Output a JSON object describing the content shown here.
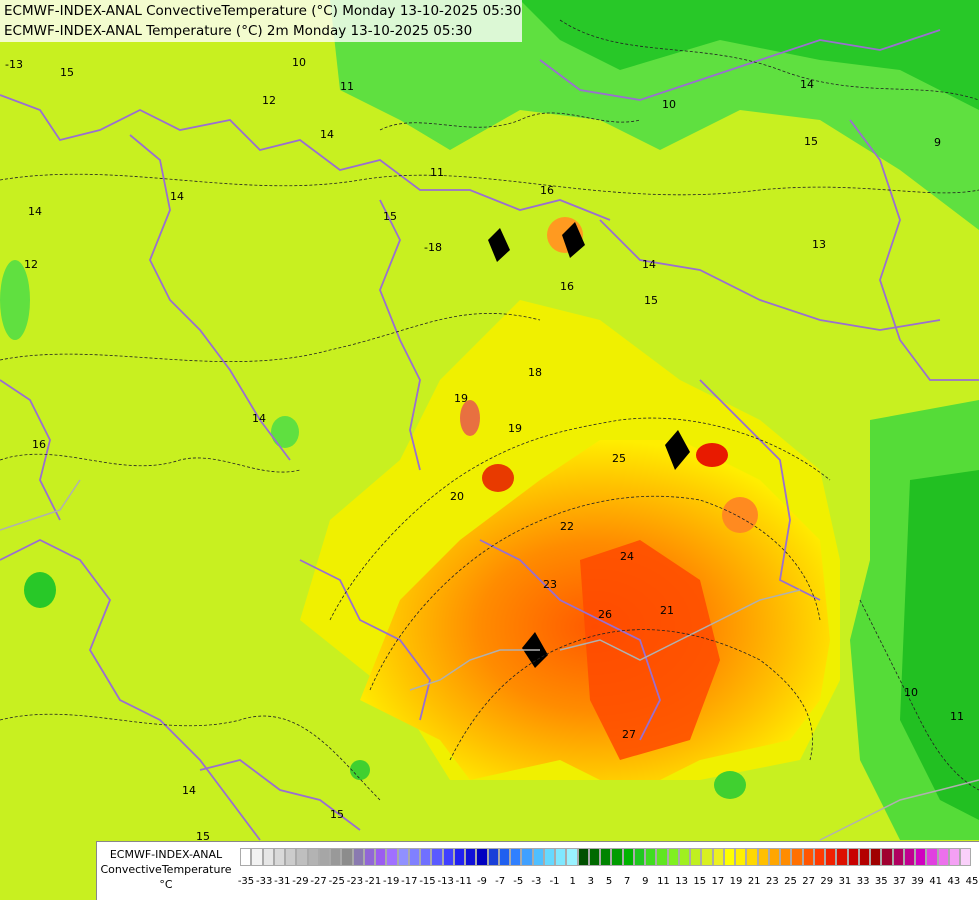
{
  "titles": {
    "line1": "ECMWF-INDEX-ANAL ConvectiveTemperature (°C) Monday 13-10-2025 05:30",
    "line2": "ECMWF-INDEX-ANAL Temperature (°C) 2m Monday 13-10-2025 05:30"
  },
  "legend": {
    "caption_line1": "ECMWF-INDEX-ANAL",
    "caption_line2": "ConvectiveTemperature",
    "caption_line3": "°C",
    "ticks": [
      "-35",
      "-33",
      "-31",
      "-29",
      "-27",
      "-25",
      "-23",
      "-21",
      "-19",
      "-17",
      "-15",
      "-13",
      "-11",
      "-9",
      "-7",
      "-5",
      "-3",
      "-1",
      "1",
      "3",
      "5",
      "7",
      "9",
      "11",
      "13",
      "15",
      "17",
      "19",
      "21",
      "23",
      "25",
      "27",
      "29",
      "31",
      "33",
      "35",
      "37",
      "39",
      "41",
      "43",
      "45"
    ],
    "colors": [
      "#ffffff",
      "#f2f2f2",
      "#e6e6e6",
      "#d9d9d9",
      "#cccccc",
      "#bfbfbf",
      "#b3b3b3",
      "#a6a6a6",
      "#999999",
      "#8c8c8c",
      "#8a7ab0",
      "#9166d6",
      "#9b5cf0",
      "#a070ff",
      "#9090ff",
      "#8080ff",
      "#7070ff",
      "#5a5aff",
      "#3f3fff",
      "#2020f0",
      "#1010d8",
      "#0000c0",
      "#1a3fd8",
      "#2060f0",
      "#3080ff",
      "#40a0ff",
      "#50bfff",
      "#66d9ff",
      "#80e8ff",
      "#99f2ff",
      "#005000",
      "#006a00",
      "#008400",
      "#009c00",
      "#00b400",
      "#20c820",
      "#40dc20",
      "#60e620",
      "#80f020",
      "#a0f020",
      "#c0f020",
      "#d8f020",
      "#ecf020",
      "#ffff00",
      "#fff000",
      "#ffd800",
      "#ffbf00",
      "#ffa600",
      "#ff8c00",
      "#ff7000",
      "#ff5500",
      "#ff3a00",
      "#f02000",
      "#dc1000",
      "#c80000",
      "#b40000",
      "#a00000",
      "#a00030",
      "#b00060",
      "#c00090",
      "#d000c0",
      "#e040e0",
      "#ec70ec",
      "#f4a0f4",
      "#fad0fa"
    ]
  },
  "map": {
    "contour_labels": [
      {
        "text": "-13"
      },
      {
        "text": "15"
      },
      {
        "text": "10"
      },
      {
        "text": "12"
      },
      {
        "text": "11"
      },
      {
        "text": "14"
      },
      {
        "text": "14"
      },
      {
        "text": "12"
      },
      {
        "text": "16"
      },
      {
        "text": "15"
      },
      {
        "text": "-18"
      },
      {
        "text": "16"
      },
      {
        "text": "14"
      },
      {
        "text": "15"
      },
      {
        "text": "11"
      },
      {
        "text": "10"
      },
      {
        "text": "9"
      },
      {
        "text": "14"
      },
      {
        "text": "15"
      },
      {
        "text": "13"
      },
      {
        "text": "18"
      },
      {
        "text": "19"
      },
      {
        "text": "19"
      },
      {
        "text": "20"
      },
      {
        "text": "22"
      },
      {
        "text": "24"
      },
      {
        "text": "23"
      },
      {
        "text": "26"
      },
      {
        "text": "21"
      },
      {
        "text": "27"
      },
      {
        "text": "14"
      },
      {
        "text": "16"
      },
      {
        "text": "15"
      },
      {
        "text": "14"
      },
      {
        "text": "10"
      },
      {
        "text": "11"
      },
      {
        "text": "15"
      },
      {
        "text": "14"
      },
      {
        "text": "25"
      }
    ]
  }
}
